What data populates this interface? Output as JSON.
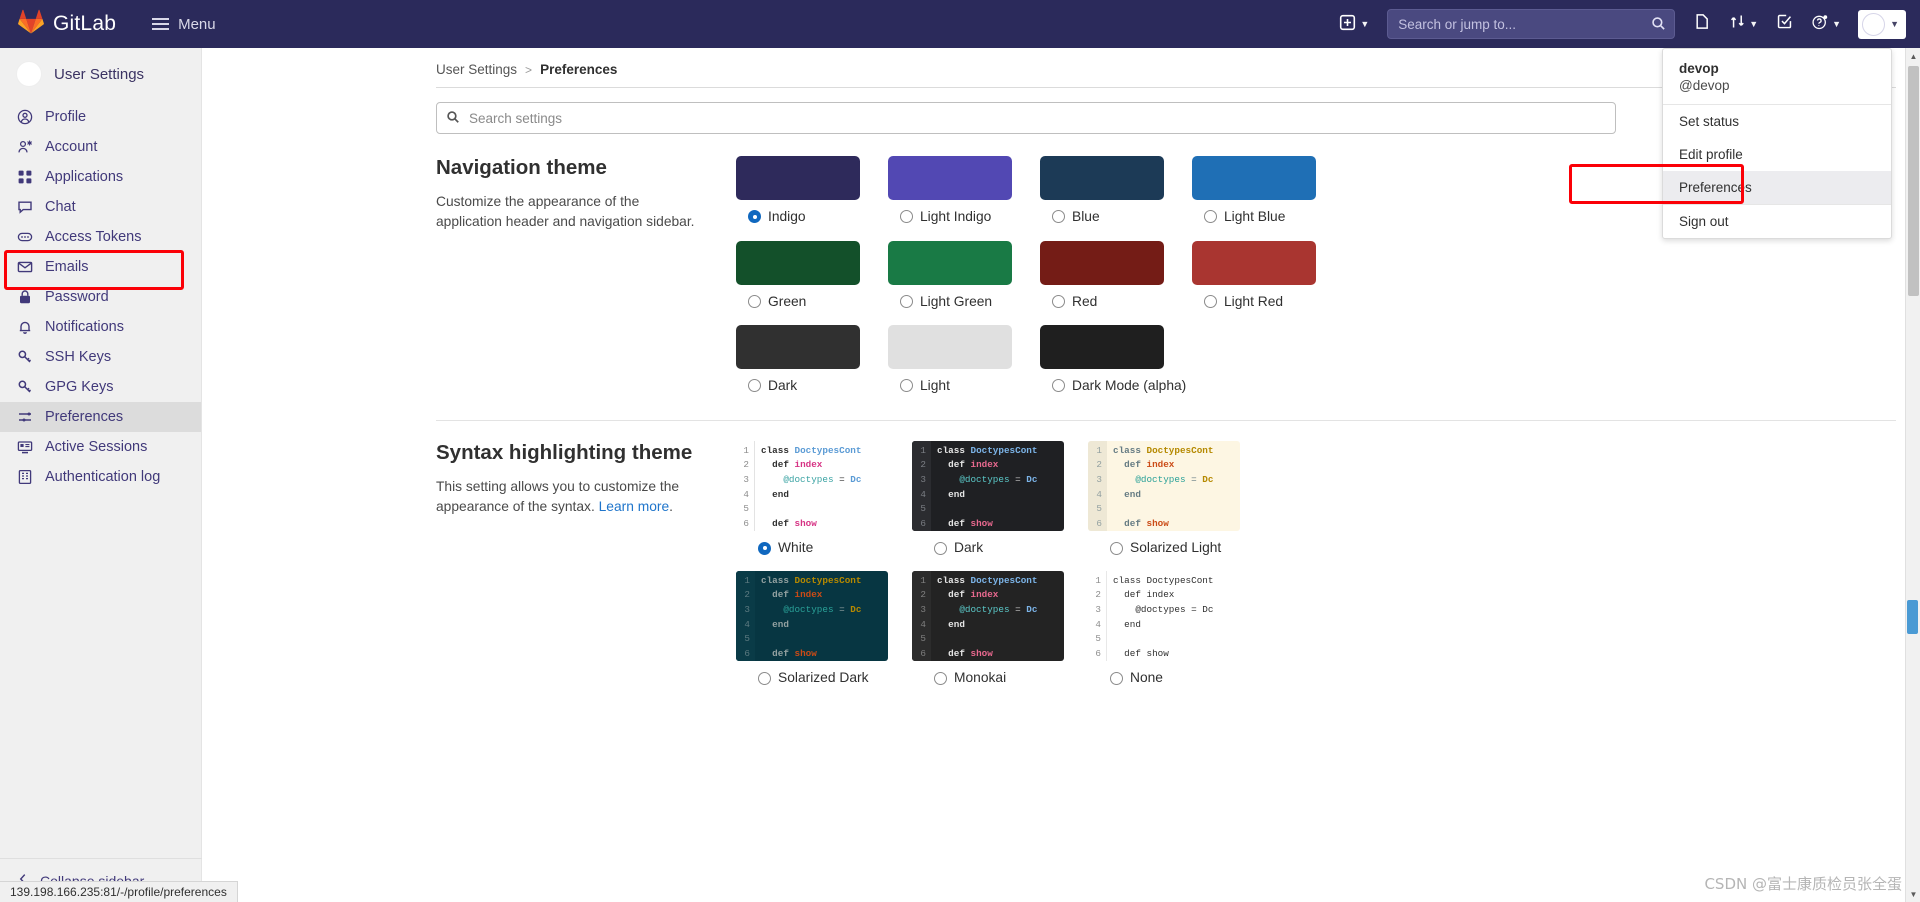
{
  "navbar": {
    "brand": "GitLab",
    "menu_label": "Menu",
    "search_placeholder": "Search or jump to...",
    "icons": {
      "plus": "plus-square-icon",
      "search": "search-icon",
      "issues": "issues-icon",
      "merge_requests": "merge-request-icon",
      "todos": "todos-icon",
      "help": "help-icon",
      "avatar": "user-avatar"
    }
  },
  "user_dropdown": {
    "name": "devop",
    "handle": "@devop",
    "items": [
      {
        "label": "Set status",
        "hover": false
      },
      {
        "label": "Edit profile",
        "hover": false
      },
      {
        "label": "Preferences",
        "hover": true
      },
      {
        "label": "Sign out",
        "hover": false
      }
    ]
  },
  "sidebar": {
    "title": "User Settings",
    "collapse_label": "Collapse sidebar",
    "items": [
      {
        "label": "Profile",
        "icon": "profile-icon",
        "active": false
      },
      {
        "label": "Account",
        "icon": "account-icon",
        "active": false
      },
      {
        "label": "Applications",
        "icon": "applications-icon",
        "active": false
      },
      {
        "label": "Chat",
        "icon": "chat-icon",
        "active": false
      },
      {
        "label": "Access Tokens",
        "icon": "token-icon",
        "active": false
      },
      {
        "label": "Emails",
        "icon": "email-icon",
        "active": false
      },
      {
        "label": "Password",
        "icon": "lock-icon",
        "active": false
      },
      {
        "label": "Notifications",
        "icon": "bell-icon",
        "active": false
      },
      {
        "label": "SSH Keys",
        "icon": "key-icon",
        "active": false
      },
      {
        "label": "GPG Keys",
        "icon": "key-icon",
        "active": false
      },
      {
        "label": "Preferences",
        "icon": "preferences-icon",
        "active": true
      },
      {
        "label": "Active Sessions",
        "icon": "monitor-icon",
        "active": false
      },
      {
        "label": "Authentication log",
        "icon": "log-icon",
        "active": false
      }
    ]
  },
  "breadcrumb": {
    "parent": "User Settings",
    "separator": ">",
    "current": "Preferences"
  },
  "search_settings": {
    "placeholder": "Search settings",
    "value": ""
  },
  "navigation_theme": {
    "title": "Navigation theme",
    "description": "Customize the appearance of the application header and navigation sidebar.",
    "themes": [
      {
        "label": "Indigo",
        "color": "#2e2a5b",
        "selected": true
      },
      {
        "label": "Light Indigo",
        "color": "#5248b3",
        "selected": false
      },
      {
        "label": "Blue",
        "color": "#1c3category",
        "selected": false
      },
      {
        "label": "Light Blue",
        "color": "#1f6fb5",
        "selected": false
      },
      {
        "label": "Green",
        "color": "#13502a",
        "selected": false
      },
      {
        "label": "Light Green",
        "color": "#197a45",
        "selected": false
      },
      {
        "label": "Red",
        "color": "#741c16",
        "selected": false
      },
      {
        "label": "Light Red",
        "color": "#a93530",
        "selected": false
      },
      {
        "label": "Dark",
        "color": "#303030",
        "selected": false
      },
      {
        "label": "Light",
        "color": "#e0e0e0",
        "selected": false
      },
      {
        "label": "Dark Mode (alpha)",
        "color": "#1f1f1f",
        "selected": false
      }
    ]
  },
  "syntax_theme": {
    "title": "Syntax highlighting theme",
    "description_1": "This setting allows you to customize the appearance of the syntax. ",
    "link_label": "Learn more",
    "description_2": ".",
    "code_sample": {
      "lines": [
        "1",
        "2",
        "3",
        "4",
        "5",
        "6"
      ],
      "content": [
        {
          "parts": [
            {
              "t": "class ",
              "c": "k"
            },
            {
              "t": "DoctypesCont",
              "c": "cls"
            }
          ]
        },
        {
          "parts": [
            {
              "t": "  def ",
              "c": "k"
            },
            {
              "t": "index",
              "c": "fn"
            }
          ]
        },
        {
          "parts": [
            {
              "t": "    @doctypes",
              "c": "iv"
            },
            {
              "t": " = ",
              "c": "op"
            },
            {
              "t": "Do",
              "c": "cls"
            }
          ]
        },
        {
          "parts": [
            {
              "t": "  end",
              "c": "k"
            }
          ]
        },
        {
          "parts": [
            {
              "t": "",
              "c": "op"
            }
          ]
        },
        {
          "parts": [
            {
              "t": "  def ",
              "c": "k"
            },
            {
              "t": "show",
              "c": "fn"
            }
          ]
        }
      ]
    },
    "options": [
      {
        "label": "White",
        "theme": "t-white",
        "selected": true
      },
      {
        "label": "Dark",
        "theme": "t-dark",
        "selected": false
      },
      {
        "label": "Solarized Light",
        "theme": "t-sollight",
        "selected": false
      },
      {
        "label": "Solarized Dark",
        "theme": "t-soldark",
        "selected": false
      },
      {
        "label": "Monokai",
        "theme": "t-monokai",
        "selected": false
      },
      {
        "label": "None",
        "theme": "t-none",
        "selected": false
      }
    ]
  },
  "statusbar": {
    "url": "139.198.166.235:81/-/profile/preferences"
  },
  "watermark": "CSDN @富士康质检员张全蛋"
}
